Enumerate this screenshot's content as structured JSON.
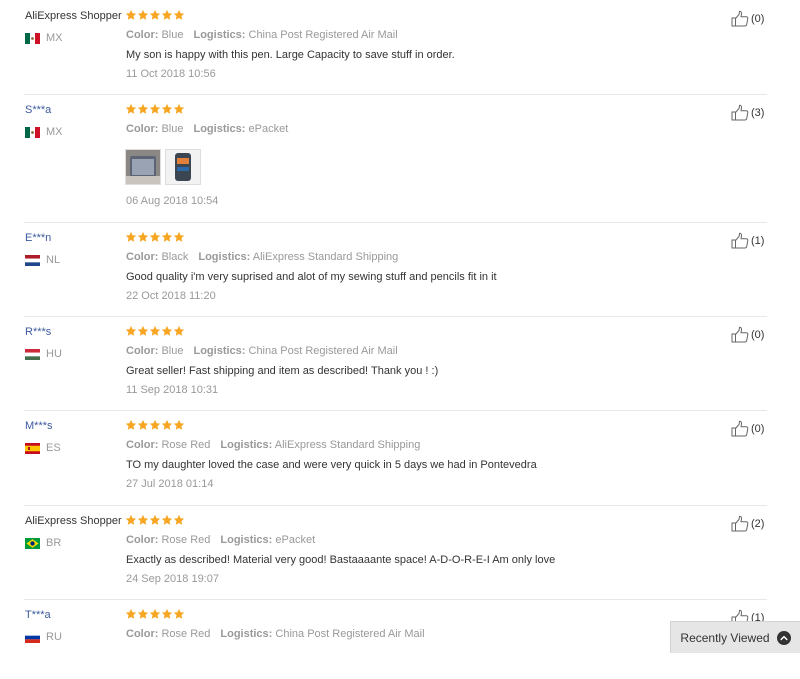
{
  "labels": {
    "color": "Color:",
    "logistics": "Logistics:"
  },
  "colors": {
    "star": "#f6a623",
    "masked_name": "#3d5a9e",
    "meta_text": "#999999"
  },
  "reviews": [
    {
      "user": "AliExpress Shopper",
      "country": "MX",
      "flag": "mexico-flag-icon",
      "rating": 5,
      "color": "Blue",
      "logistics": "China Post Registered Air Mail",
      "text": "My son is happy with this pen. Large Capacity to save stuff in order.",
      "date": "11 Oct 2018 10:56",
      "helpful": "(0)"
    },
    {
      "user": "S***a",
      "country": "MX",
      "flag": "mexico-flag-icon",
      "rating": 5,
      "color": "Blue",
      "logistics": "ePacket",
      "text": "",
      "photos": [
        "review-photo-1",
        "review-photo-2"
      ],
      "date": "06 Aug 2018 10:54",
      "helpful": "(3)"
    },
    {
      "user": "E***n",
      "country": "NL",
      "flag": "netherlands-flag-icon",
      "rating": 5,
      "color": "Black",
      "logistics": "AliExpress Standard Shipping",
      "text": "Good quality i'm very suprised and alot of my sewing stuff and pencils fit in it",
      "date": "22 Oct 2018 11:20",
      "helpful": "(1)"
    },
    {
      "user": "R***s",
      "country": "HU",
      "flag": "hungary-flag-icon",
      "rating": 5,
      "color": "Blue",
      "logistics": "China Post Registered Air Mail",
      "text": "Great seller! Fast shipping and item as described! Thank you ! :)",
      "date": "11 Sep 2018 10:31",
      "helpful": "(0)"
    },
    {
      "user": "M***s",
      "country": "ES",
      "flag": "spain-flag-icon",
      "rating": 5,
      "color": "Rose Red",
      "logistics": "AliExpress Standard Shipping",
      "text": "TO my daughter loved the case and were very quick in 5 days we had in Pontevedra",
      "date": "27 Jul 2018 01:14",
      "helpful": "(0)"
    },
    {
      "user": "AliExpress Shopper",
      "country": "BR",
      "flag": "brazil-flag-icon",
      "rating": 5,
      "color": "Rose Red",
      "logistics": "ePacket",
      "text": "Exactly as described! Material very good! Bastaaaante space! A-D-O-R-E-I Am only love",
      "date": "24 Sep 2018 19:07",
      "helpful": "(2)"
    },
    {
      "user": "T***a",
      "country": "RU",
      "flag": "russia-flag-icon",
      "rating": 5,
      "color": "Rose Red",
      "logistics": "China Post Registered Air Mail",
      "text": "",
      "date": "",
      "helpful": "(1)"
    }
  ],
  "recently_viewed": {
    "label": "Recently Viewed",
    "icon": "chevron-up-icon"
  }
}
